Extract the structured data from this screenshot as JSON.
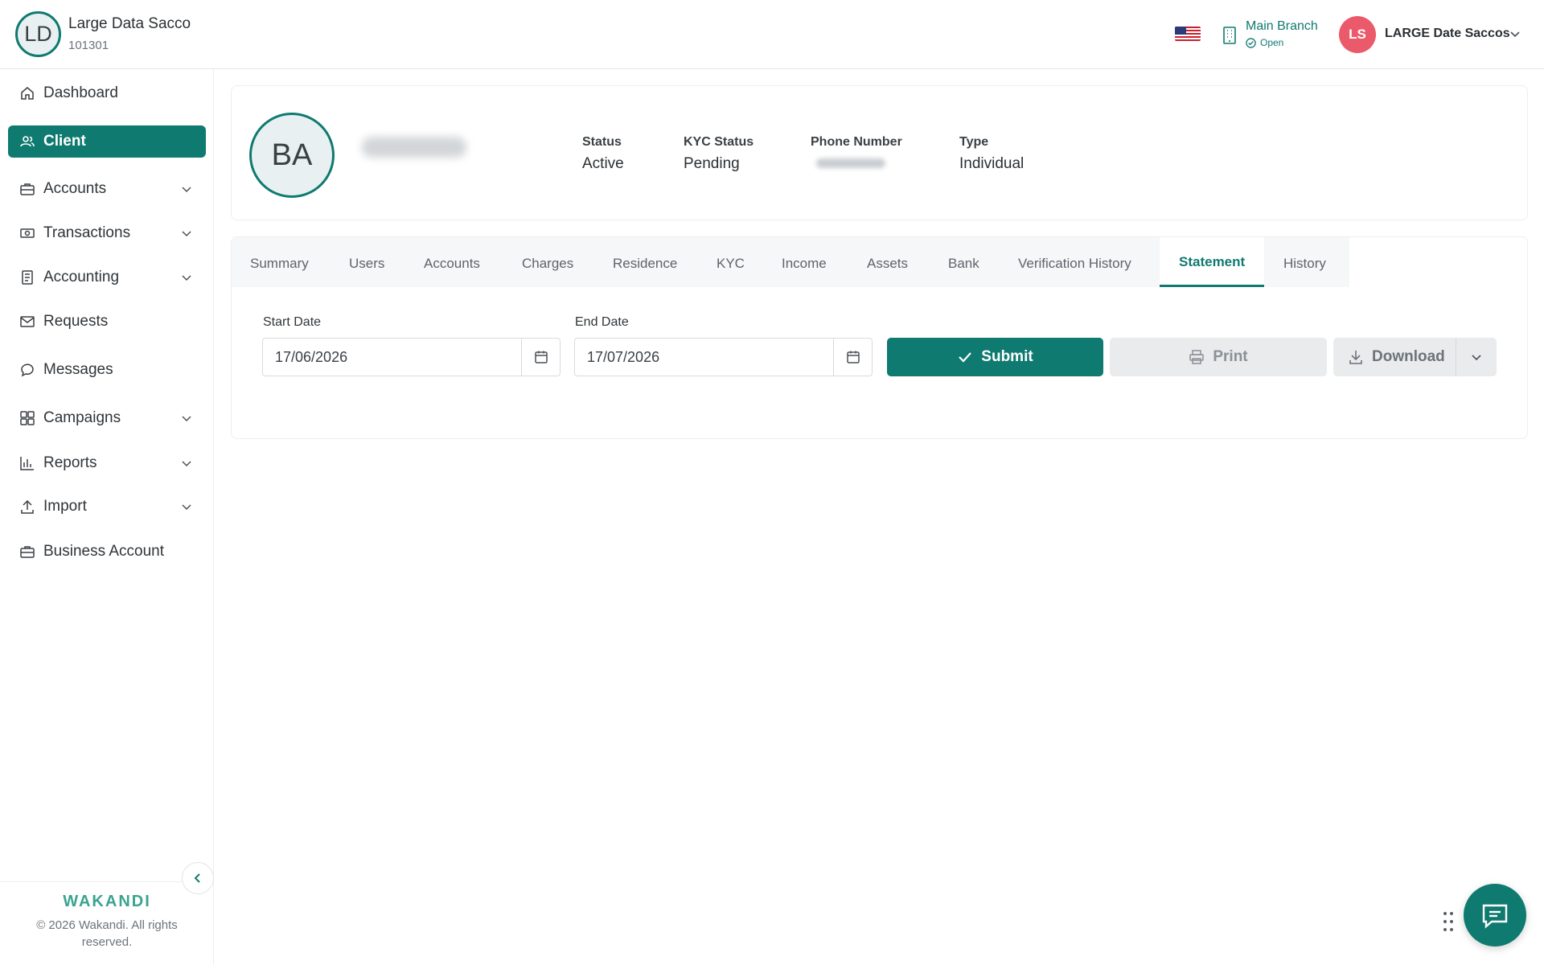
{
  "org": {
    "initials": "LD",
    "name": "Large Data Sacco",
    "code": "101301"
  },
  "header": {
    "branch_name": "Main Branch",
    "branch_status": "Open",
    "user_initials": "LS",
    "user_name": "LARGE Date Saccos"
  },
  "sidebar": {
    "items": [
      {
        "label": "Dashboard",
        "icon": "home-icon",
        "expandable": false,
        "active": false
      },
      {
        "label": "Client",
        "icon": "users-icon",
        "expandable": false,
        "active": true
      },
      {
        "label": "Accounts",
        "icon": "briefcase-icon",
        "expandable": true,
        "active": false
      },
      {
        "label": "Transactions",
        "icon": "cash-icon",
        "expandable": true,
        "active": false
      },
      {
        "label": "Accounting",
        "icon": "ledger-icon",
        "expandable": true,
        "active": false
      },
      {
        "label": "Requests",
        "icon": "mail-icon",
        "expandable": false,
        "active": false
      },
      {
        "label": "Messages",
        "icon": "chat-icon",
        "expandable": false,
        "active": false
      },
      {
        "label": "Campaigns",
        "icon": "grid-icon",
        "expandable": true,
        "active": false
      },
      {
        "label": "Reports",
        "icon": "bar-chart-icon",
        "expandable": true,
        "active": false
      },
      {
        "label": "Import",
        "icon": "upload-icon",
        "expandable": true,
        "active": false
      },
      {
        "label": "Business Account",
        "icon": "briefcase-icon",
        "expandable": false,
        "active": false
      }
    ],
    "brand": "WAKANDI",
    "copyright": "© 2026 Wakandi. All rights reserved."
  },
  "client": {
    "initials": "BA",
    "stats": [
      {
        "label": "Status",
        "value": "Active"
      },
      {
        "label": "KYC Status",
        "value": "Pending"
      },
      {
        "label": "Phone Number",
        "value": ""
      },
      {
        "label": "Type",
        "value": "Individual"
      }
    ]
  },
  "tabs": [
    {
      "label": "Summary",
      "active": false
    },
    {
      "label": "Users",
      "active": false
    },
    {
      "label": "Accounts",
      "active": false
    },
    {
      "label": "Charges",
      "active": false
    },
    {
      "label": "Residence",
      "active": false
    },
    {
      "label": "KYC",
      "active": false
    },
    {
      "label": "Income",
      "active": false
    },
    {
      "label": "Assets",
      "active": false
    },
    {
      "label": "Bank",
      "active": false
    },
    {
      "label": "Verification History",
      "active": false
    },
    {
      "label": "Statement",
      "active": true
    },
    {
      "label": "History",
      "active": false
    }
  ],
  "statement": {
    "start_label": "Start Date",
    "start_value": "17/06/2026",
    "end_label": "End Date",
    "end_value": "17/07/2026",
    "submit_label": "Submit",
    "print_label": "Print",
    "download_label": "Download"
  },
  "colors": {
    "primary": "#0f7a70",
    "avatar_user": "#ea5a6a",
    "disabled_button": "#e9ebed"
  }
}
